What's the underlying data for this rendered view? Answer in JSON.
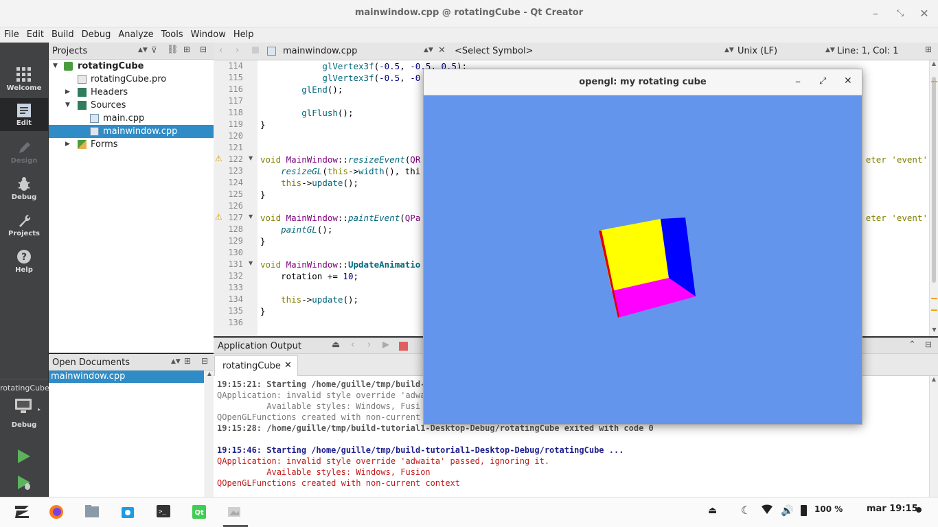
{
  "window_title": "mainwindow.cpp @ rotatingCube - Qt Creator",
  "menu": [
    "File",
    "Edit",
    "Build",
    "Debug",
    "Analyze",
    "Tools",
    "Window",
    "Help"
  ],
  "modes": [
    {
      "label": "Welcome",
      "icon": "grid-icon"
    },
    {
      "label": "Edit",
      "icon": "document-icon"
    },
    {
      "label": "Design",
      "icon": "pen-icon"
    },
    {
      "label": "Debug",
      "icon": "bug-icon"
    },
    {
      "label": "Projects",
      "icon": "wrench-icon"
    },
    {
      "label": "Help",
      "icon": "help-icon"
    }
  ],
  "kit": {
    "project": "rotatingCube",
    "mode": "Debug"
  },
  "projects": {
    "title": "Projects",
    "tree": [
      {
        "label": "rotatingCube",
        "type": "project"
      },
      {
        "label": "rotatingCube.pro",
        "type": "pro"
      },
      {
        "label": "Headers",
        "type": "folder-h"
      },
      {
        "label": "Sources",
        "type": "folder-c"
      },
      {
        "label": "main.cpp",
        "type": "cpp"
      },
      {
        "label": "mainwindow.cpp",
        "type": "cpp"
      },
      {
        "label": "Forms",
        "type": "folder-f"
      }
    ]
  },
  "open_documents": {
    "title": "Open Documents",
    "items": [
      "mainwindow.cpp"
    ]
  },
  "editor": {
    "file": "mainwindow.cpp",
    "symbol": "<Select Symbol>",
    "line_ending": "Unix (LF)",
    "position": "Line: 1, Col: 1",
    "line_numbers": [
      "114",
      "115",
      "116",
      "117",
      "118",
      "119",
      "120",
      "121",
      "122",
      "123",
      "124",
      "125",
      "126",
      "127",
      "128",
      "129",
      "130",
      "131",
      "132",
      "133",
      "134",
      "135",
      "136"
    ],
    "code_lines": [
      "            glVertex3f(-0.5, -0.5, 0.5);",
      "            glVertex3f(-0.5, -0",
      "        glEnd();",
      "",
      "        glFlush();",
      "}",
      "",
      "",
      "void MainWindow::resizeEvent(QR",
      "    resizeGL(this->width(), thi",
      "    this->update();",
      "}",
      "",
      "void MainWindow::paintEvent(QPa",
      "    paintGL();",
      "}",
      "",
      "void MainWindow::UpdateAnimatio",
      "    rotation += 10;",
      "",
      "    this->update();",
      "}",
      ""
    ],
    "warning_tail": "eter 'event'"
  },
  "output": {
    "title": "Application Output",
    "tab": "rotatingCube",
    "lines": [
      {
        "text": "19:15:21: Starting /home/guille/tmp/build-",
        "style": "gb"
      },
      {
        "text": "QApplication: invalid style override 'adwa",
        "style": "g"
      },
      {
        "text": "          Available styles: Windows, Fusi",
        "style": "g"
      },
      {
        "text": "QOpenGLFunctions created with non-current",
        "style": "g"
      },
      {
        "text": "19:15:28: /home/guille/tmp/build-tutorial1-Desktop-Debug/rotatingCube exited with code 0",
        "style": "gb"
      },
      {
        "text": "",
        "style": "g"
      },
      {
        "text": "19:15:46: Starting /home/guille/tmp/build-tutorial1-Desktop-Debug/rotatingCube ...",
        "style": "b"
      },
      {
        "text": "QApplication: invalid style override 'adwaita' passed, ignoring it.",
        "style": "r"
      },
      {
        "text": "          Available styles: Windows, Fusion",
        "style": "r"
      },
      {
        "text": "QOpenGLFunctions created with non-current context",
        "style": "r"
      }
    ]
  },
  "gl_window": {
    "title": "opengl: my rotating cube",
    "background": "#6495ed",
    "faces": {
      "front": "#ffff00",
      "side": "#0000ff",
      "bottom": "#ff00ff"
    }
  },
  "taskbar": {
    "apps": [
      "zorin-menu-icon",
      "firefox-icon",
      "files-icon",
      "software-icon",
      "terminal-icon",
      "qt-creator-icon",
      "image-viewer-icon"
    ],
    "battery": "100 %",
    "clock": "mar 19:15"
  }
}
